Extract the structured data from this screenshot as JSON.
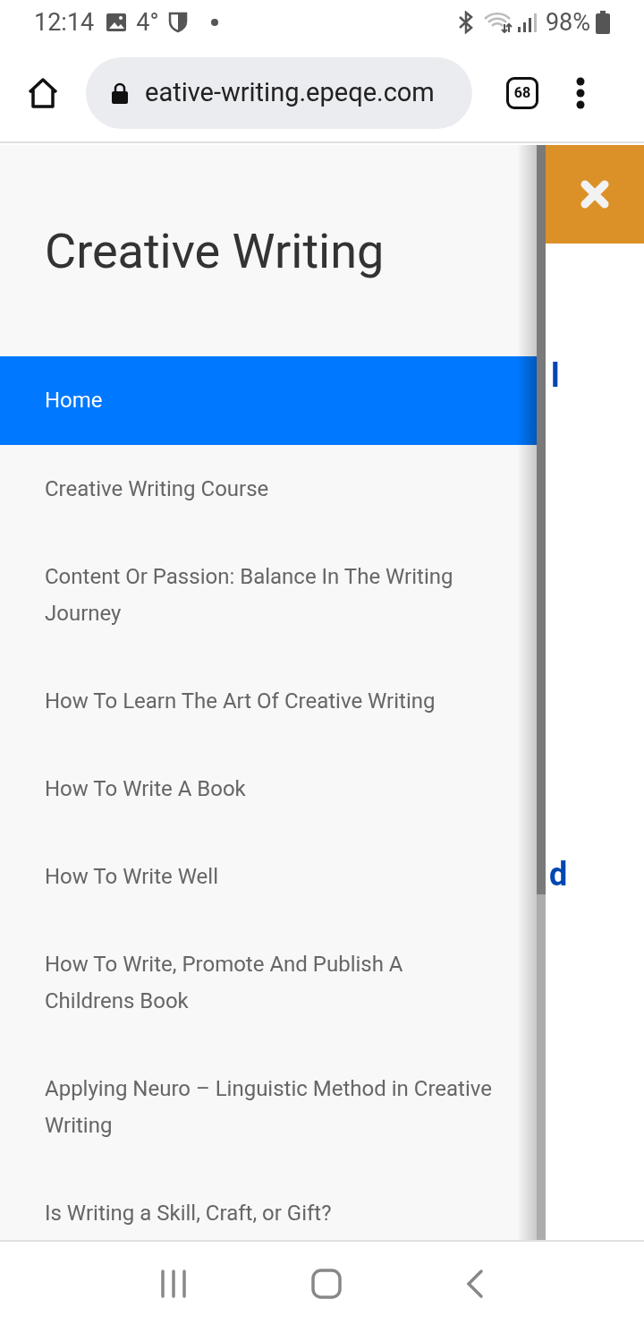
{
  "status_bar": {
    "time": "12:14",
    "temperature": "4°",
    "battery": "98%"
  },
  "browser": {
    "url": "eative-writing.epeqe.com",
    "tab_count": "68"
  },
  "drawer": {
    "title": "Creative Writing",
    "items": [
      {
        "label": "Home",
        "selected": true
      },
      {
        "label": "Creative Writing Course",
        "selected": false
      },
      {
        "label": "Content Or Passion: Balance In The Writing Journey",
        "selected": false
      },
      {
        "label": "How To Learn The Art Of Creative Writing",
        "selected": false
      },
      {
        "label": "How To Write A Book",
        "selected": false
      },
      {
        "label": "How To Write Well",
        "selected": false
      },
      {
        "label": "How To Write, Promote And Publish A Childrens Book",
        "selected": false
      },
      {
        "label": "Applying Neuro – Linguistic Method in Creative Writing",
        "selected": false
      },
      {
        "label": "Is Writing a Skill, Craft, or Gift?",
        "selected": false
      }
    ]
  },
  "page_behind": {
    "fragments": [
      "l",
      "d"
    ]
  }
}
